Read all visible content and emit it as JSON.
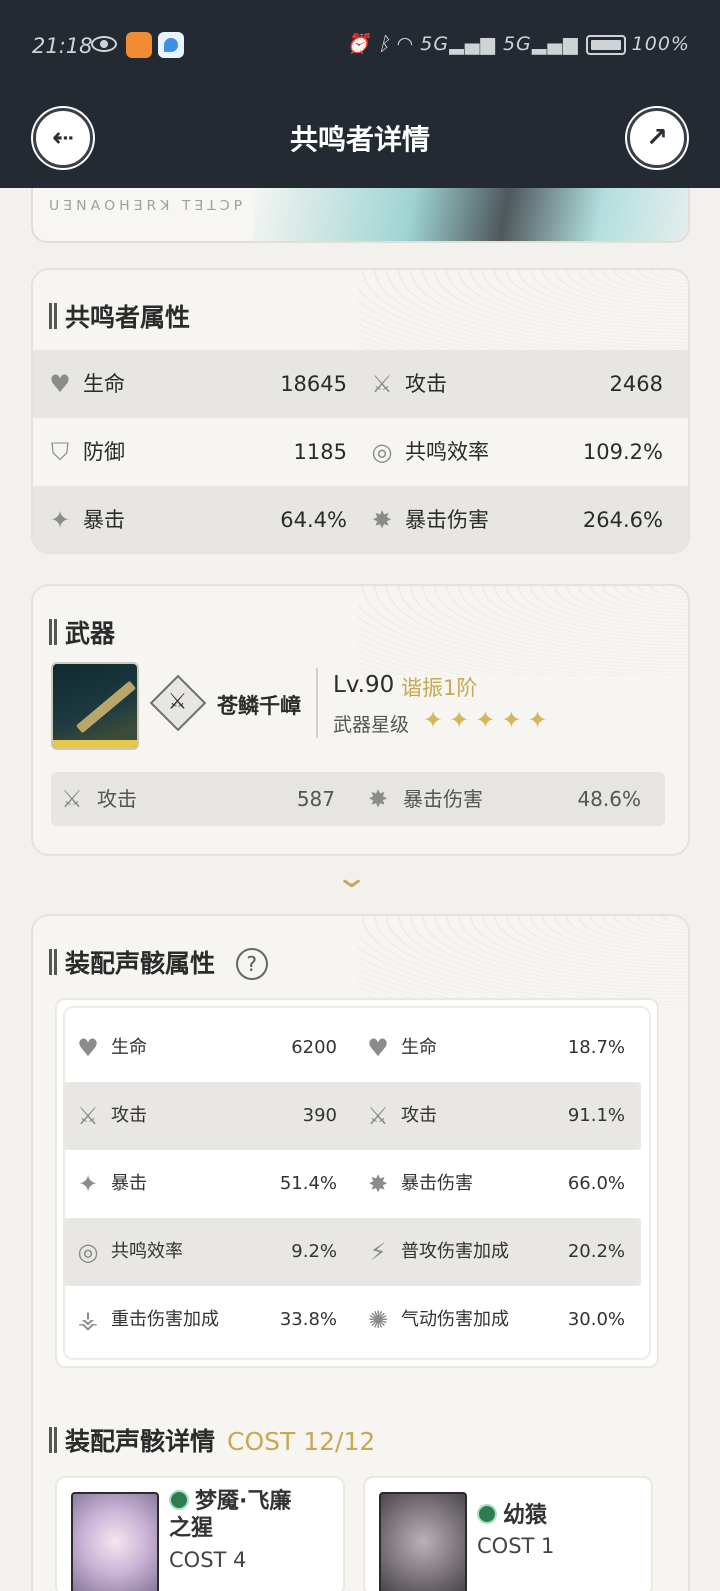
{
  "status_bar": {
    "time": "21:18",
    "network_1": "5G",
    "network_2": "5G",
    "battery": "100%"
  },
  "header": {
    "title": "共鸣者详情",
    "back_icon": "back-icon",
    "share_icon": "share-icon"
  },
  "hero": {
    "runes": "ꓴꓱꓠꓮꓳꓧꓱꓣꓘ ꓔꓱꓕꓛꓑ"
  },
  "attributes": {
    "title": "共鸣者属性",
    "rows": [
      {
        "l_label": "生命",
        "l_value": "18645",
        "l_icon": "heart-icon",
        "r_label": "攻击",
        "r_value": "2468",
        "r_icon": "swords-icon"
      },
      {
        "l_label": "防御",
        "l_value": "1185",
        "l_icon": "shield-icon",
        "r_label": "共鸣效率",
        "r_value": "109.2%",
        "r_icon": "energy-icon"
      },
      {
        "l_label": "暴击",
        "l_value": "64.4%",
        "l_icon": "crit-icon",
        "r_label": "暴击伤害",
        "r_value": "264.6%",
        "r_icon": "crit-damage-icon"
      }
    ]
  },
  "weapon": {
    "title": "武器",
    "name": "苍鳞千嶂",
    "level": "Lv.90",
    "tune": "谐振1阶",
    "star_label": "武器星级",
    "stars": 5,
    "stars_text": "✦✦✦✦✦",
    "sub": [
      {
        "label": "攻击",
        "value": "587",
        "icon": "swords-icon"
      },
      {
        "label": "暴击伤害",
        "value": "48.6%",
        "icon": "crit-damage-icon"
      }
    ]
  },
  "echo_attributes": {
    "title": "装配声骸属性",
    "help": "?",
    "rows": [
      {
        "l_label": "生命",
        "l_value": "6200",
        "r_label": "生命",
        "r_value": "18.7%"
      },
      {
        "l_label": "攻击",
        "l_value": "390",
        "r_label": "攻击",
        "r_value": "91.1%"
      },
      {
        "l_label": "暴击",
        "l_value": "51.4%",
        "r_label": "暴击伤害",
        "r_value": "66.0%"
      },
      {
        "l_label": "共鸣效率",
        "l_value": "9.2%",
        "r_label": "普攻伤害加成",
        "r_value": "20.2%"
      },
      {
        "l_label": "重击伤害加成",
        "l_value": "33.8%",
        "r_label": "气动伤害加成",
        "r_value": "30.0%"
      }
    ]
  },
  "echo_details": {
    "title": "装配声骸详情",
    "cost": "COST 12/12",
    "items": [
      {
        "name_line1": "梦魇·飞廉",
        "name_line2": "之猩",
        "cost": "COST 4"
      },
      {
        "name_line1": "幼猿",
        "name_line2": "",
        "cost": "COST 1"
      }
    ]
  }
}
